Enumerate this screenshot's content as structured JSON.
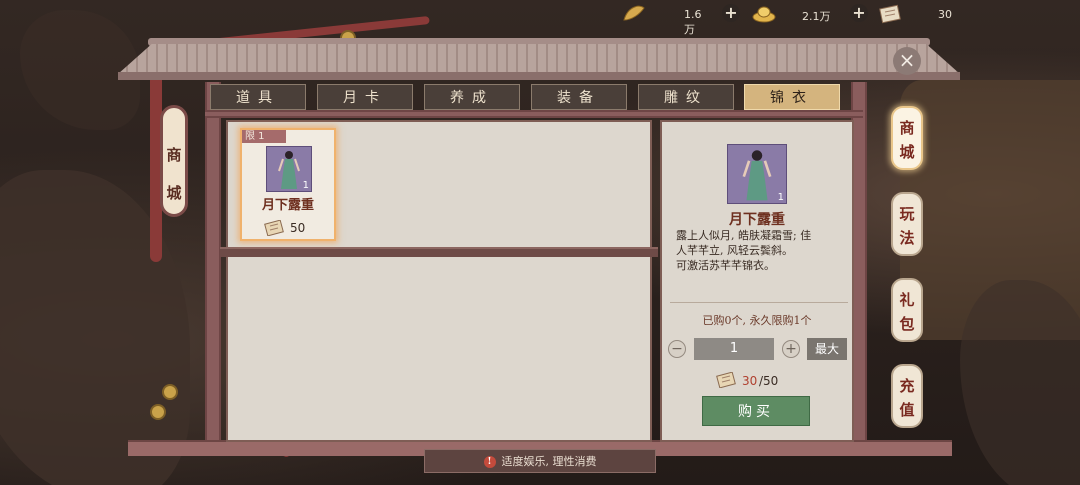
{
  "currency": {
    "gold_value": "1.6万",
    "ingot_value": "2.1万",
    "scroll_value": "30"
  },
  "tabs": [
    "道具",
    "月卡",
    "养成",
    "装备",
    "雕纹",
    "锦衣"
  ],
  "active_tab": "锦衣",
  "left_tab": {
    "label_line1": "商",
    "label_line2": "城"
  },
  "item": {
    "limit_label": "限 1",
    "quantity": "1",
    "name": "月下露重",
    "price": "50"
  },
  "detail": {
    "quantity": "1",
    "name": "月下露重",
    "description_line1": "露上人似月, 皓肤凝霜雪; 佳",
    "description_line2": "人芊芊立, 风轻云鬓斜。",
    "description_line3": "可激活苏芊芊锦衣。",
    "purchase_info": "已购0个, 永久限购1个",
    "stepper_value": "1",
    "max_label": "最大",
    "cost_have": "30",
    "cost_need": "/50",
    "buy_label": "购买"
  },
  "side_tabs": [
    {
      "l1": "商",
      "l2": "城"
    },
    {
      "l1": "玩",
      "l2": "法"
    },
    {
      "l1": "礼",
      "l2": "包"
    },
    {
      "l1": "充",
      "l2": "值"
    }
  ],
  "footer": {
    "warning_icon": "!",
    "text": "适度娱乐, 理性消费"
  },
  "close_label": "×",
  "colors": {
    "active_tab": "#d4b47e",
    "buy_button": "#5e8c63",
    "cost_have": "#b0402f",
    "highlight_glow": "#f0b26c"
  }
}
